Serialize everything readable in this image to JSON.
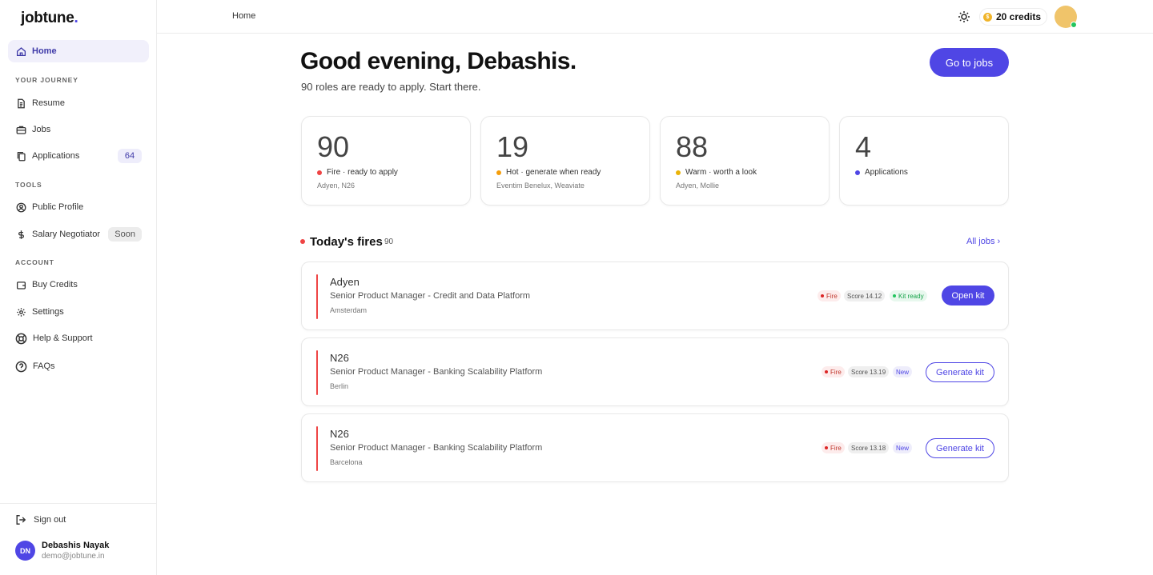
{
  "app": {
    "logo": "jobtune",
    "logo_dot": "."
  },
  "sidebar": {
    "home": "Home",
    "journey_label": "YOUR JOURNEY",
    "resume": "Resume",
    "jobs": "Jobs",
    "applications": "Applications",
    "applications_count": "64",
    "tools_label": "TOOLS",
    "public_profile": "Public Profile",
    "salary_negotiator": "Salary Negotiator",
    "salary_badge": "Soon",
    "account_label": "ACCOUNT",
    "buy_credits": "Buy Credits",
    "settings": "Settings",
    "help": "Help & Support",
    "faqs": "FAQs",
    "sign_out": "Sign out",
    "user_initials": "DN",
    "user_name": "Debashis Nayak",
    "user_email": "demo@jobtune.in"
  },
  "topbar": {
    "breadcrumb": "Home",
    "credits": "20 credits",
    "coin_symbol": "$"
  },
  "main": {
    "greeting": "Good evening, Debashis.",
    "subgreeting": "90 roles are ready to apply. Start there.",
    "go_jobs": "Go to jobs",
    "stats": [
      {
        "value": "90",
        "label": "Fire · ready to apply",
        "sub": "Adyen, N26",
        "color": "#ef4444"
      },
      {
        "value": "19",
        "label": "Hot · generate when ready",
        "sub": "Eventim Benelux, Weaviate",
        "color": "#f59e0b"
      },
      {
        "value": "88",
        "label": "Warm · worth a look",
        "sub": "Adyen, Mollie",
        "color": "#eab308"
      },
      {
        "value": "4",
        "label": "Applications",
        "sub": "",
        "color": "#4f46e5"
      }
    ],
    "fires_title": "Today's fires",
    "fires_count": "90",
    "all_jobs": "All jobs ›",
    "jobs": [
      {
        "company": "Adyen",
        "title": "Senior Product Manager - Credit and Data Platform",
        "location": "Amsterdam",
        "fire": "Fire",
        "score": "Score 14.12",
        "status": "Kit ready",
        "action": "Open kit"
      },
      {
        "company": "N26",
        "title": "Senior Product Manager - Banking Scalability Platform",
        "location": "Berlin",
        "fire": "Fire",
        "score": "Score 13.19",
        "status": "New",
        "action": "Generate kit"
      },
      {
        "company": "N26",
        "title": "Senior Product Manager - Banking Scalability Platform",
        "location": "Barcelona",
        "fire": "Fire",
        "score": "Score 13.18",
        "status": "New",
        "action": "Generate kit"
      }
    ]
  },
  "colors": {
    "accent": "#4f46e5",
    "fire": "#ef4444",
    "online": "#22c55e"
  }
}
